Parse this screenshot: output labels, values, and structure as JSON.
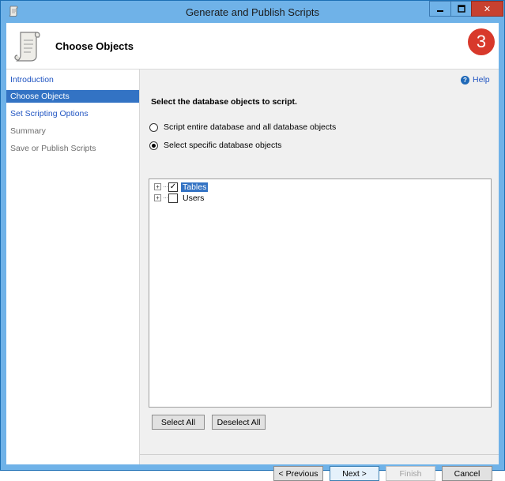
{
  "window": {
    "title": "Generate and Publish Scripts",
    "close_label": "✕"
  },
  "header": {
    "page_title": "Choose Objects",
    "step_badge": "3"
  },
  "sidebar": {
    "items": [
      {
        "label": "Introduction",
        "state": "link"
      },
      {
        "label": "Choose Objects",
        "state": "active"
      },
      {
        "label": "Set Scripting Options",
        "state": "link"
      },
      {
        "label": "Summary",
        "state": "disabled"
      },
      {
        "label": "Save or Publish Scripts",
        "state": "disabled"
      }
    ]
  },
  "main": {
    "help_label": "Help",
    "instruction": "Select the database objects to script.",
    "radio_entire": "Script entire database and all database objects",
    "radio_specific": "Select specific database objects",
    "selected_option": "Select specific database objects",
    "tree": [
      {
        "label": "Tables",
        "checked": true,
        "selected": true
      },
      {
        "label": "Users",
        "checked": false,
        "selected": false
      }
    ],
    "select_all": "Select All",
    "deselect_all": "Deselect All"
  },
  "footer": {
    "previous": "< Previous",
    "next": "Next >",
    "finish": "Finish",
    "cancel": "Cancel"
  },
  "colors": {
    "title_bar": "#6fb2e8",
    "close_button": "#c74130",
    "selection": "#3373c4",
    "link": "#2155c2",
    "badge": "#d8392b"
  }
}
